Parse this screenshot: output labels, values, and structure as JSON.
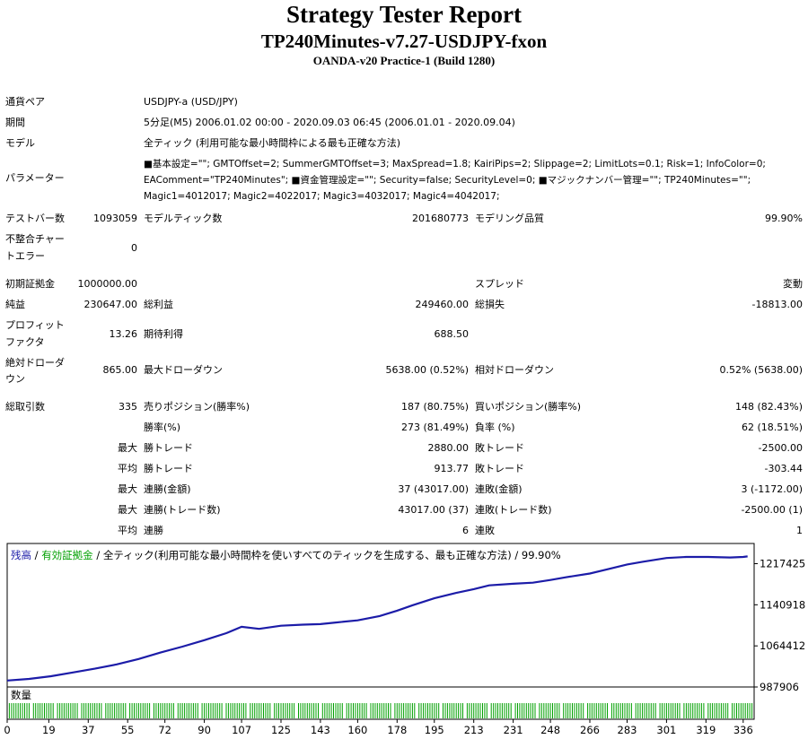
{
  "report": {
    "title": "Strategy Tester Report",
    "subtitle": "TP240Minutes-v7.27-USDJPY-fxon",
    "build": "OANDA-v20 Practice-1 (Build 1280)"
  },
  "settings": {
    "pair_label": "通貨ペア",
    "pair_value": "USDJPY-a (USD/JPY)",
    "period_label": "期間",
    "period_value": "5分足(M5) 2006.01.02 00:00 - 2020.09.03 06:45 (2006.01.01 - 2020.09.04)",
    "model_label": "モデル",
    "model_value": "全ティック (利用可能な最小時間枠による最も正確な方法)",
    "params_label": "パラメーター",
    "params_line1": "■基本設定=\"\"; GMTOffset=2; SummerGMTOffset=3; MaxSpread=1.8; KairiPips=2; Slippage=2; LimitLots=0.1; Risk=1; InfoColor=0;",
    "params_line2": "EAComment=\"TP240Minutes\"; ■資金管理設定=\"\"; Security=false; SecurityLevel=0; ■マジックナンバー管理=\"\"; TP240Minutes=\"\";",
    "params_line3": "Magic1=4012017; Magic2=4022017; Magic3=4032017; Magic4=4042017;"
  },
  "stats": {
    "bars_label": "テストバー数",
    "bars_value": "1093059",
    "ticks_label": "モデルティック数",
    "ticks_value": "201680773",
    "quality_label": "モデリング品質",
    "quality_value": "99.90%",
    "mismatch_label_1": "不整合チャー",
    "mismatch_label_2": "トエラー",
    "mismatch_value": "0",
    "deposit_label": "初期証拠金",
    "deposit_value": "1000000.00",
    "spread_label": "スプレッド",
    "spread_value": "変動",
    "net_label": "純益",
    "net_value": "230647.00",
    "gross_profit_label": "総利益",
    "gross_profit_value": "249460.00",
    "gross_loss_label": "総損失",
    "gross_loss_value": "-18813.00",
    "pf_label_1": "プロフィット",
    "pf_label_2": "ファクタ",
    "pf_value": "13.26",
    "expected_label": "期待利得",
    "expected_value": "688.50",
    "abs_dd_label_1": "絶対ドローダ",
    "abs_dd_label_2": "ウン",
    "abs_dd_value": "865.00",
    "max_dd_label": "最大ドローダウン",
    "max_dd_value": "5638.00 (0.52%)",
    "rel_dd_label": "相対ドローダウン",
    "rel_dd_value": "0.52% (5638.00)",
    "total_trades_label": "総取引数",
    "total_trades_value": "335",
    "short_label": "売りポジション(勝率%)",
    "short_value": "187 (80.75%)",
    "long_label": "買いポジション(勝率%)",
    "long_value": "148 (82.43%)",
    "win_rate_label": "勝率(%)",
    "win_rate_value": "273 (81.49%)",
    "loss_rate_label": "負率 (%)",
    "loss_rate_value": "62 (18.51%)",
    "max_word": "最大",
    "avg_word": "平均",
    "max_win_label": "勝トレード",
    "max_win_value": "2880.00",
    "max_loss_label": "敗トレード",
    "max_loss_value": "-2500.00",
    "avg_win_label": "勝トレード",
    "avg_win_value": "913.77",
    "avg_loss_label": "敗トレード",
    "avg_loss_value": "-303.44",
    "max_consec_win_amt_label": "連勝(金額)",
    "max_consec_win_amt_value": "37 (43017.00)",
    "max_consec_loss_amt_label": "連敗(金額)",
    "max_consec_loss_amt_value": "3 (-1172.00)",
    "max_consec_win_cnt_label": "連勝(トレード数)",
    "max_consec_win_cnt_value": "43017.00 (37)",
    "max_consec_loss_cnt_label": "連敗(トレード数)",
    "max_consec_loss_cnt_value": "-2500.00 (1)",
    "avg_consec_win_label": "連勝",
    "avg_consec_win_value": "6",
    "avg_consec_loss_label": "連敗",
    "avg_consec_loss_value": "1"
  },
  "chart_data": {
    "type": "line",
    "legend_balance": "残高",
    "legend_sep1": " / ",
    "legend_equity": "有効証拠金",
    "legend_sep2": " / ",
    "legend_desc": "全ティック(利用可能な最小時間枠を使いすべてのティックを生成する、最も正確な方法) / 99.90%",
    "volume_label": "数量",
    "ylim": [
      987906,
      1255000
    ],
    "y_ticks": [
      "1217425",
      "1140918",
      "1064412",
      "987906"
    ],
    "y_tick_values": [
      1217425,
      1140918,
      1064412,
      987906
    ],
    "x_ticks": [
      "0",
      "19",
      "37",
      "55",
      "72",
      "90",
      "107",
      "125",
      "143",
      "160",
      "178",
      "195",
      "213",
      "231",
      "248",
      "266",
      "283",
      "301",
      "319",
      "336"
    ],
    "xlim": [
      0,
      341
    ],
    "colors": {
      "balance": "#1c1ca8",
      "equity": "#00a000",
      "volume": "#00a000"
    },
    "series": [
      {
        "name": "残高",
        "x": [
          0,
          10,
          20,
          30,
          40,
          50,
          60,
          70,
          80,
          90,
          100,
          107,
          115,
          125,
          135,
          143,
          150,
          160,
          170,
          178,
          185,
          195,
          205,
          213,
          220,
          231,
          240,
          248,
          255,
          266,
          275,
          283,
          290,
          301,
          310,
          320,
          330,
          336,
          338
        ],
        "y": [
          1000000,
          1003000,
          1008000,
          1015000,
          1022000,
          1030000,
          1040000,
          1052000,
          1063000,
          1075000,
          1088000,
          1100000,
          1096000,
          1102000,
          1104000,
          1105000,
          1108000,
          1112000,
          1120000,
          1130000,
          1140000,
          1153000,
          1163000,
          1170000,
          1177000,
          1180000,
          1182000,
          1187000,
          1192000,
          1199000,
          1208000,
          1216000,
          1221000,
          1228000,
          1230000,
          1230000,
          1229000,
          1230000,
          1231000
        ]
      }
    ]
  }
}
